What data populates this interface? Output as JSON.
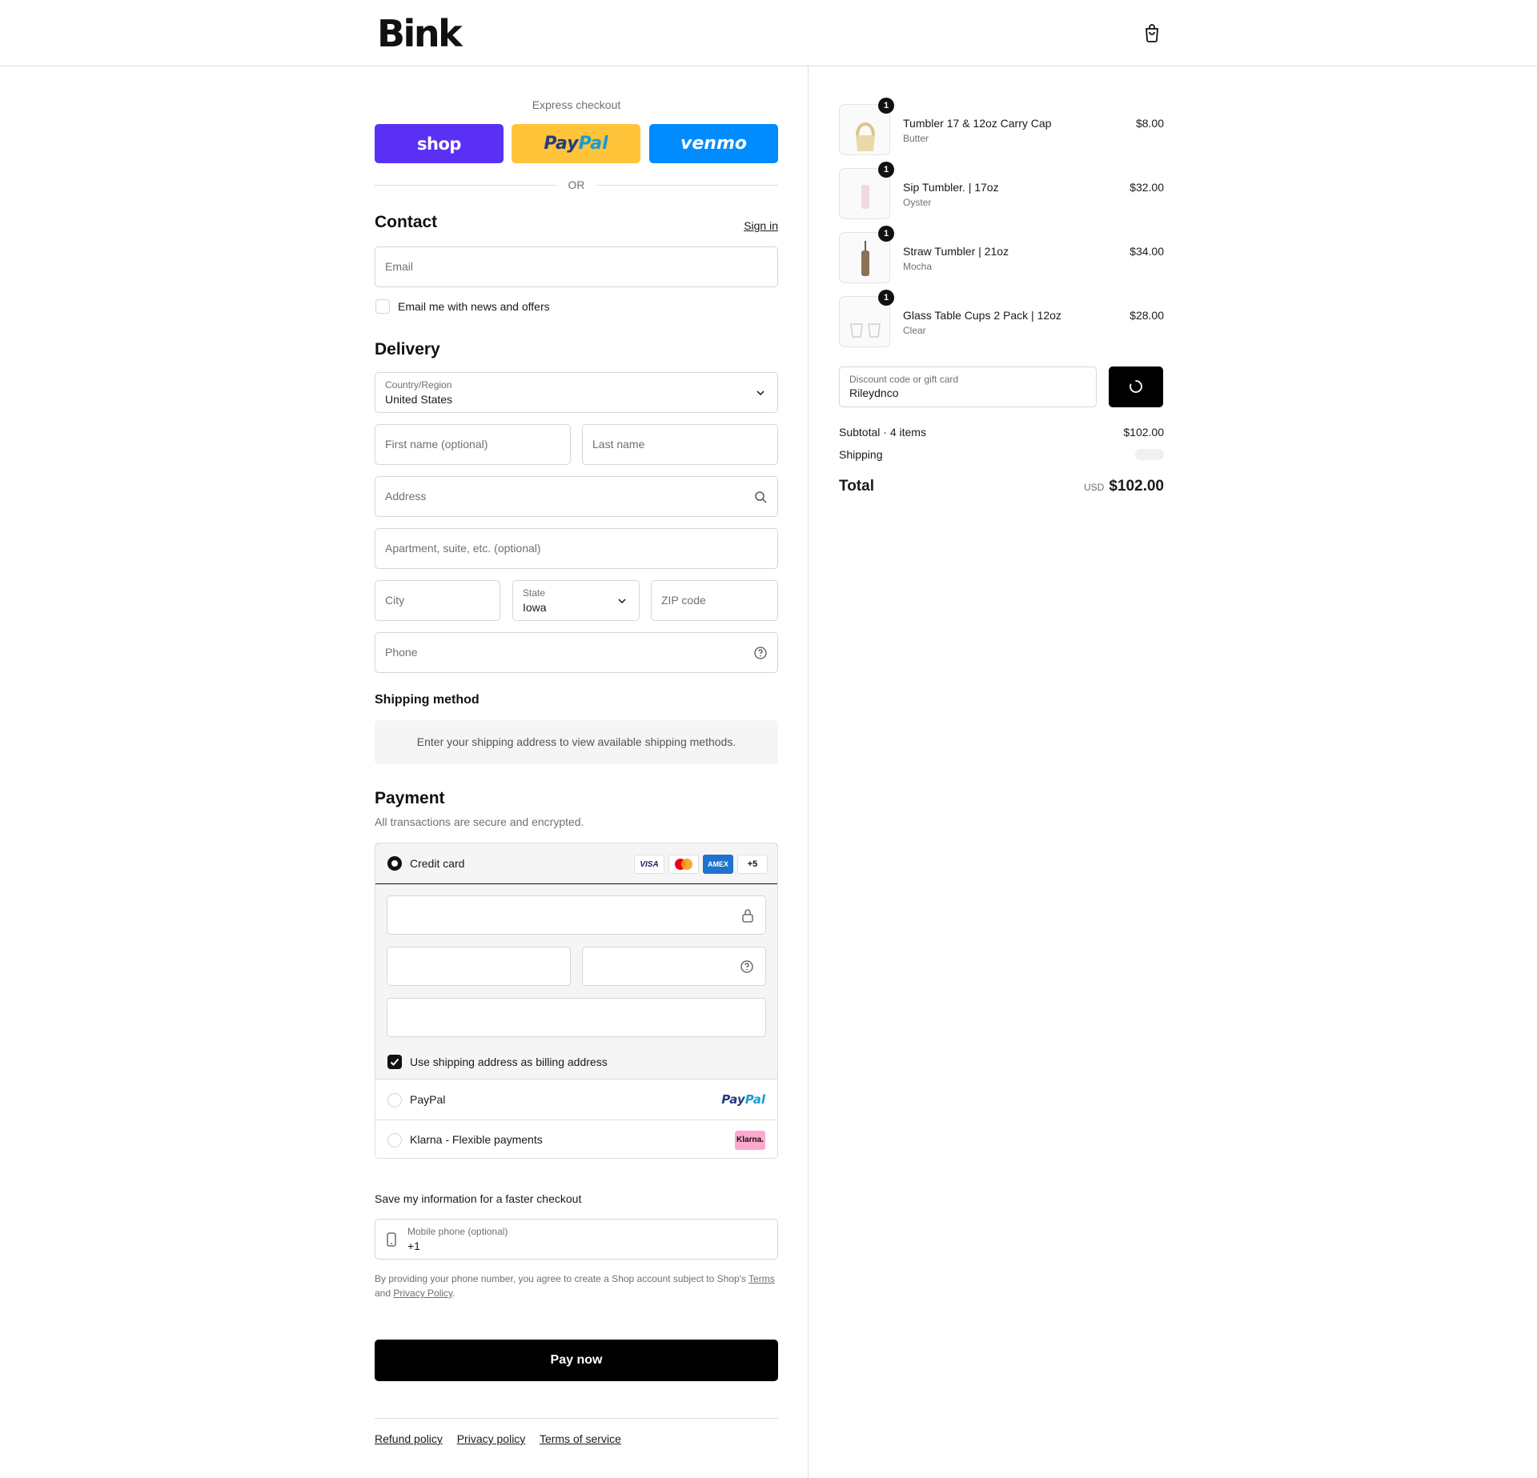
{
  "header": {
    "logo": "Bink",
    "cart_icon": "shopping-bag-icon"
  },
  "express": {
    "title": "Express checkout",
    "shop": "shop",
    "paypal_part1": "Pay",
    "paypal_part2": "Pal",
    "venmo": "venmo",
    "or": "OR"
  },
  "contact": {
    "heading": "Contact",
    "sign_in": "Sign in",
    "email_placeholder": "Email",
    "newsletter_label": "Email me with news and offers"
  },
  "delivery": {
    "heading": "Delivery",
    "country_label": "Country/Region",
    "country_value": "United States",
    "first_name_placeholder": "First name (optional)",
    "last_name_placeholder": "Last name",
    "address_placeholder": "Address",
    "apartment_placeholder": "Apartment, suite, etc. (optional)",
    "city_placeholder": "City",
    "state_label": "State",
    "state_value": "Iowa",
    "zip_placeholder": "ZIP code",
    "phone_placeholder": "Phone"
  },
  "shipping_method": {
    "heading": "Shipping method",
    "message": "Enter your shipping address to view available shipping methods."
  },
  "payment": {
    "heading": "Payment",
    "subtitle": "All transactions are secure and encrypted.",
    "credit_card_label": "Credit card",
    "brands": {
      "visa": "VISA",
      "amex": "AMEX",
      "more": "+5"
    },
    "billing_label": "Use shipping address as billing address",
    "paypal_label": "PayPal",
    "paypal_logo_part1": "Pay",
    "paypal_logo_part2": "Pal",
    "klarna_label": "Klarna - Flexible payments",
    "klarna_logo": "Klarna."
  },
  "save_info": {
    "heading": "Save my information for a faster checkout",
    "mobile_label": "Mobile phone (optional)",
    "mobile_value": "+1",
    "disclaimer_part1": "By providing your phone number, you agree to create a Shop account subject to Shop's",
    "terms_link": "Terms",
    "disclaimer_and": "and",
    "privacy_link": "Privacy Policy",
    "disclaimer_end": "."
  },
  "pay_now": "Pay now",
  "footer": {
    "refund": "Refund policy",
    "privacy": "Privacy policy",
    "terms": "Terms of service"
  },
  "cart": {
    "items": [
      {
        "name": "Tumbler 17 & 12oz Carry Cap",
        "variant": "Butter",
        "price": "$8.00",
        "qty": "1"
      },
      {
        "name": "Sip Tumbler. | 17oz",
        "variant": "Oyster",
        "price": "$32.00",
        "qty": "1"
      },
      {
        "name": "Straw Tumbler | 21oz",
        "variant": "Mocha",
        "price": "$34.00",
        "qty": "1"
      },
      {
        "name": "Glass Table Cups 2 Pack | 12oz",
        "variant": "Clear",
        "price": "$28.00",
        "qty": "1"
      }
    ],
    "discount_label": "Discount code or gift card",
    "discount_value": "Rileydnco",
    "subtotal_label": "Subtotal · 4 items",
    "subtotal_value": "$102.00",
    "shipping_label": "Shipping",
    "total_label": "Total",
    "currency": "USD",
    "total_value": "$102.00"
  },
  "colors": {
    "shop": "#5a31f4",
    "paypal": "#ffc439",
    "venmo": "#008cff",
    "klarna": "#ffa8cd",
    "amex": "#1f72cd"
  }
}
